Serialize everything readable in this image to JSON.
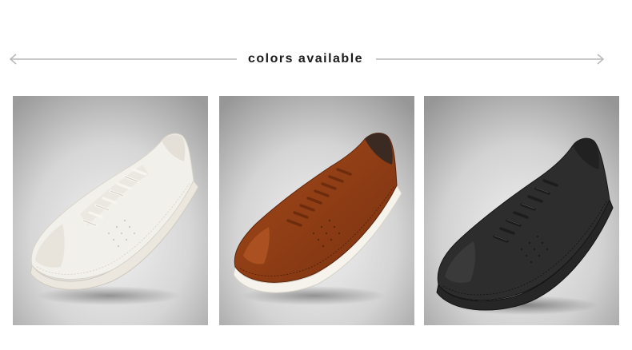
{
  "heading": "colors available",
  "products": [
    {
      "variant": "white",
      "upper": "#f1efea",
      "sole": "#ece8e0",
      "lace": "#f6f4ef",
      "heel": "#e8e4dc"
    },
    {
      "variant": "brown",
      "upper": "#8e3c14",
      "sole": "#f4f1ea",
      "lace": "#6e2c0d",
      "heel": "#3b2a22"
    },
    {
      "variant": "black",
      "upper": "#2c2c2c",
      "sole": "#2a2a2a",
      "lace": "#1f1f1f",
      "heel": "#242424"
    }
  ],
  "colors": {
    "divider": "#b9b9b9",
    "tile_bg_top": "#9a9a9a",
    "tile_bg_center": "#efefef"
  }
}
